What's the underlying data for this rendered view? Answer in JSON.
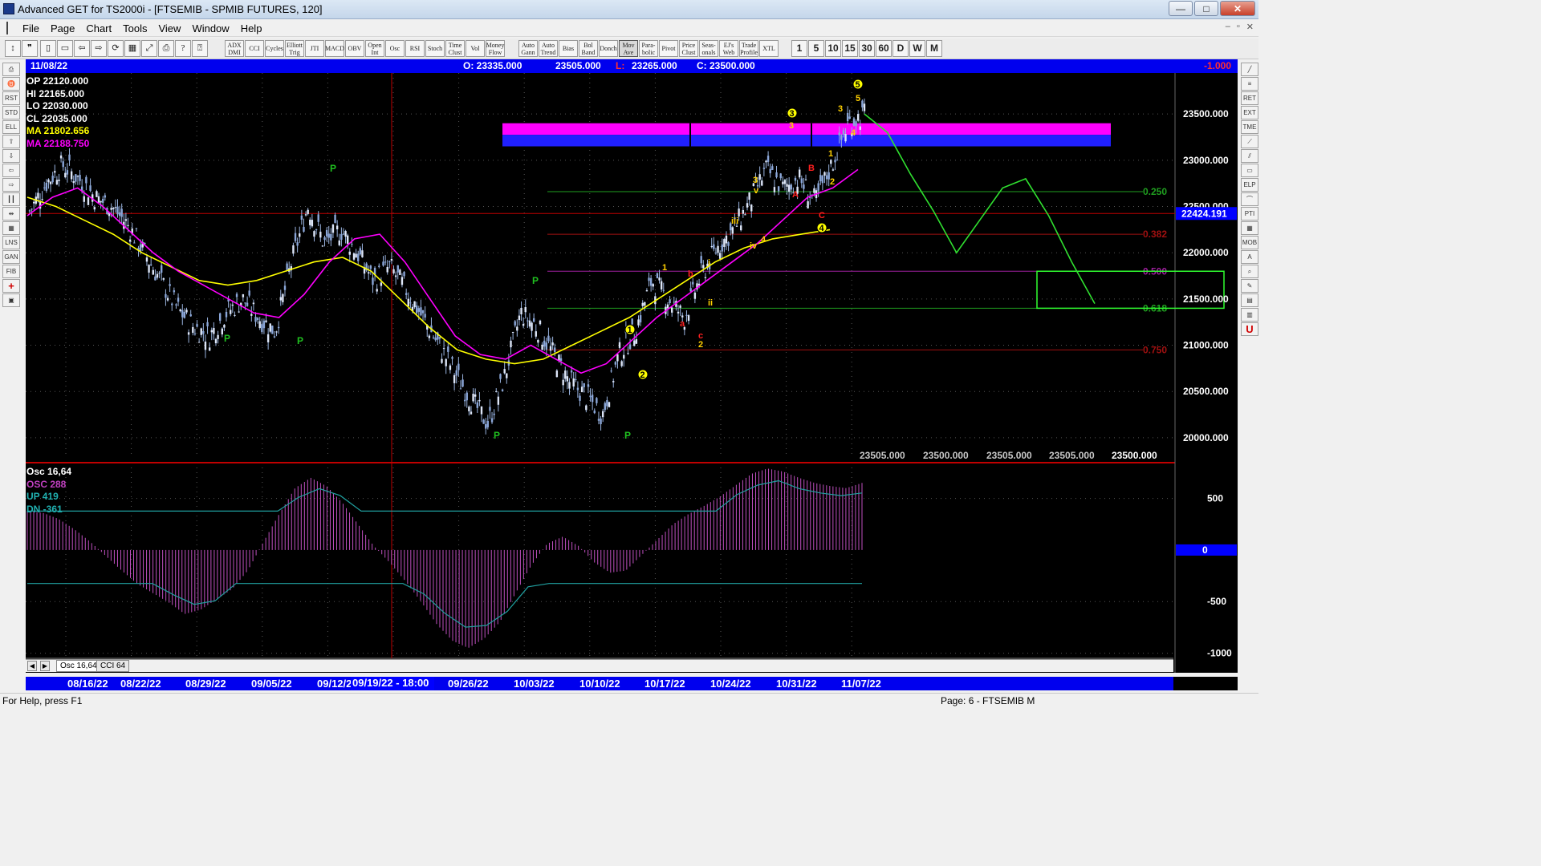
{
  "window": {
    "title": "Advanced GET for TS2000i - [FTSEMIB - SPMIB FUTURES, 120]",
    "minimize": "—",
    "maximize": "□",
    "close": "✕"
  },
  "menu": [
    "File",
    "Page",
    "Chart",
    "Tools",
    "View",
    "Window",
    "Help"
  ],
  "toolbar": {
    "indicators": [
      "ADX DMI",
      "CCI",
      "Cycles",
      "Elliott Trig",
      "JTI",
      "MACD",
      "OBV",
      "Open Int",
      "Osc",
      "RSI",
      "Stoch",
      "Time Clust",
      "Vol",
      "Money Flow"
    ],
    "studies": [
      "Auto Gann",
      "Auto Trend",
      "Bias",
      "Bol Band",
      "Donch",
      "Mov Ave",
      "Para-bolic",
      "Pivot",
      "Price Clust",
      "Seas-onals",
      "EJ's Web",
      "Trade Profile",
      "XTL"
    ],
    "timeframes": [
      "1",
      "5",
      "10",
      "15",
      "30",
      "60",
      "D",
      "W",
      "M"
    ]
  },
  "info_bar": {
    "date": "11/08/22",
    "open": "O: 23335.000",
    "high": "23505.000",
    "low_label": "L:",
    "low": "23265.000",
    "close": "C: 23500.000",
    "change": "-1.000",
    "colors": {
      "bg": "#0000ee",
      "low_label": "#ff3030",
      "change": "#ff3030"
    }
  },
  "price_readout": {
    "op": "OP  22120.000",
    "hi": "HI   22165.000",
    "lo": "LO  22030.000",
    "cl": "CL  22035.000",
    "ma1": "MA  21802.656",
    "ma2": "MA  22188.750",
    "colors": {
      "text": "#ffffff",
      "ma1": "#ffff00",
      "ma2": "#ff00ff"
    }
  },
  "osc_readout": {
    "title": "Osc 16,64",
    "osc": "OSC 288",
    "up": "UP   419",
    "dn": "DN   -361",
    "colors": {
      "title": "#ffffff",
      "osc": "#c040c0",
      "up": "#20b0b0",
      "dn": "#20b0b0"
    }
  },
  "chart_data": [
    {
      "type": "candlestick",
      "title": "FTSEMIB - SPMIB FUTURES, 120",
      "ylim": [
        19800,
        23900
      ],
      "y_ticks": [
        "23500.000",
        "23000.000",
        "22500.000",
        "22000.000",
        "21500.000",
        "21000.000",
        "20500.000",
        "20000.000"
      ],
      "y_tick_values": [
        23500,
        23000,
        22500,
        22000,
        21500,
        21000,
        20500,
        20000
      ],
      "current_price_label": "22424.191",
      "current_price": 22424.191,
      "x_dates": [
        "08/16/22",
        "08/22/22",
        "08/29/22",
        "09/05/22",
        "09/12/22",
        "09/19/22",
        "09/26/22",
        "10/03/22",
        "10/10/22",
        "10/17/22",
        "10/24/22",
        "10/31/22",
        "11/07/22"
      ],
      "cursor_date": "09/19/22 - 18:00",
      "close_path": [
        22450,
        22750,
        22950,
        22800,
        22600,
        22500,
        22300,
        22000,
        21700,
        21400,
        21200,
        21100,
        21350,
        21500,
        21300,
        21150,
        21900,
        22500,
        22100,
        22250,
        22000,
        21700,
        21850,
        21600,
        21300,
        21000,
        20700,
        20400,
        20150,
        20650,
        21350,
        21200,
        20900,
        20600,
        20450,
        20250,
        20900,
        21150,
        21700,
        21500,
        21300,
        21750,
        22050,
        22250,
        22550,
        22900,
        22700,
        22800,
        22550,
        22950,
        23400,
        23500
      ],
      "ma_yellow": [
        22600,
        22500,
        22350,
        22200,
        22000,
        21850,
        21700,
        21650,
        21700,
        21800,
        21900,
        21950,
        21800,
        21500,
        21200,
        20950,
        20850,
        20800,
        20850,
        21000,
        21150,
        21300,
        21500,
        21700,
        21900,
        22050,
        22150,
        22200,
        22250
      ],
      "ma_magenta": [
        22400,
        22600,
        22700,
        22500,
        22250,
        22000,
        21800,
        21650,
        21500,
        21350,
        21300,
        21550,
        21900,
        22150,
        22200,
        21900,
        21500,
        21100,
        20900,
        20850,
        21000,
        20850,
        20700,
        20800,
        21050,
        21300,
        21500,
        21700,
        21900,
        22100,
        22350,
        22600,
        22700,
        22900
      ],
      "fib_levels": [
        {
          "label": "0.250",
          "value": 22660,
          "color": "#20a020"
        },
        {
          "label": "0.382",
          "value": 22200,
          "color": "#a01010"
        },
        {
          "label": "0.500",
          "value": 21800,
          "color": "#a020a0"
        },
        {
          "label": "0.618",
          "value": 21400,
          "color": "#20a020"
        },
        {
          "label": "0.750",
          "value": 20950,
          "color": "#a01010"
        }
      ],
      "projection": [
        23500,
        23300,
        22850,
        22450,
        22000,
        22350,
        22700,
        22800,
        22400,
        21900,
        21450
      ],
      "target_zone": [
        21400,
        21800
      ],
      "resistance_zone": [
        23150,
        23400
      ],
      "pivot_labels": [
        "P",
        "P",
        "P",
        "P",
        "P",
        "P",
        "P",
        "P"
      ],
      "elliott_labels": {
        "yellow_circle": [
          "1",
          "2",
          "3",
          "4",
          "5"
        ],
        "small": [
          "1",
          "2",
          "3",
          "4",
          "5",
          "i",
          "ii",
          "iii",
          "iv",
          "v",
          "3",
          "5",
          "1",
          "2",
          "3",
          "4",
          "5"
        ],
        "red": [
          "a",
          "b",
          "c",
          "A",
          "B",
          "C"
        ]
      },
      "price_bottom_labels": [
        "23505.000",
        "23500.000",
        "23505.000",
        "23505.000",
        "23500.000"
      ]
    },
    {
      "type": "bar",
      "title": "Osc 16,64",
      "ylim": [
        -1050,
        800
      ],
      "y_ticks": [
        "500",
        "-500",
        "-1000"
      ],
      "y_tick_values": [
        500,
        -500,
        -1000
      ],
      "zero_label": "0",
      "values": [
        380,
        360,
        300,
        200,
        80,
        -60,
        -200,
        -330,
        -420,
        -510,
        -620,
        -580,
        -480,
        -380,
        -200,
        80,
        350,
        600,
        700,
        620,
        460,
        250,
        40,
        -120,
        -300,
        -500,
        -720,
        -880,
        -950,
        -860,
        -700,
        -420,
        -150,
        60,
        130,
        40,
        -120,
        -220,
        -200,
        -50,
        100,
        250,
        350,
        430,
        520,
        630,
        740,
        790,
        760,
        700,
        650,
        620,
        600,
        650
      ],
      "upper_band": 419,
      "lower_band": -361
    }
  ],
  "tabs": [
    "Osc 16,64",
    "CCI 64"
  ],
  "status": {
    "left": "For Help, press F1",
    "right": "Page: 6 - FTSEMIB M"
  }
}
